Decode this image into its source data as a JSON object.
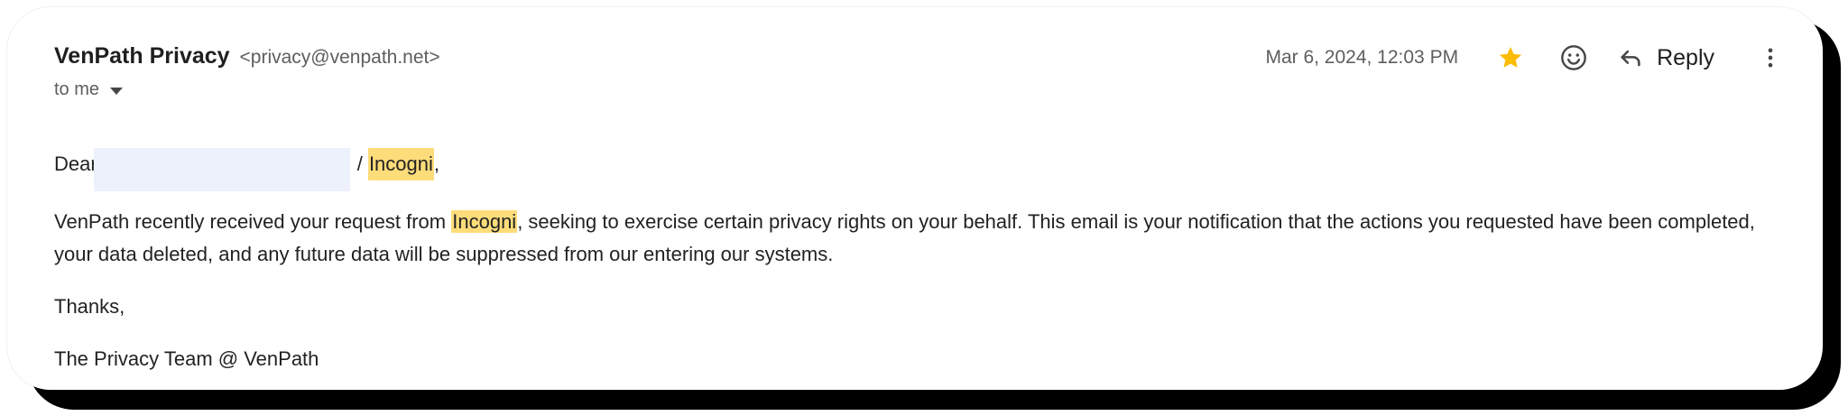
{
  "email": {
    "sender_name": "VenPath Privacy",
    "sender_email": "<privacy@venpath.net>",
    "recipient": "to me",
    "date": "Mar 6, 2024, 12:03 PM",
    "reply_label": "Reply",
    "starred": true
  },
  "body": {
    "greeting_prefix": "Dear",
    "greeting_separator": "/",
    "greeting_company": "Incogni",
    "greeting_suffix": ",",
    "para1_prefix": "VenPath recently received your request from",
    "para1_company": "Incogni",
    "para1_suffix": ", seeking to exercise certain privacy rights on your behalf. This email is your notification that the actions you requested have been completed, your data deleted, and any future data will be suppressed from our entering our systems.",
    "thanks": "Thanks,",
    "signature": "The Privacy Team @ VenPath"
  },
  "icons": {
    "star": "star-icon",
    "emoji": "emoji-icon",
    "reply": "reply-icon",
    "more": "more-vert-icon",
    "dropdown": "chevron-down-icon"
  },
  "colors": {
    "star": "#fbbc04",
    "highlight": "#fddc7a",
    "redaction": "#edf1fb"
  }
}
